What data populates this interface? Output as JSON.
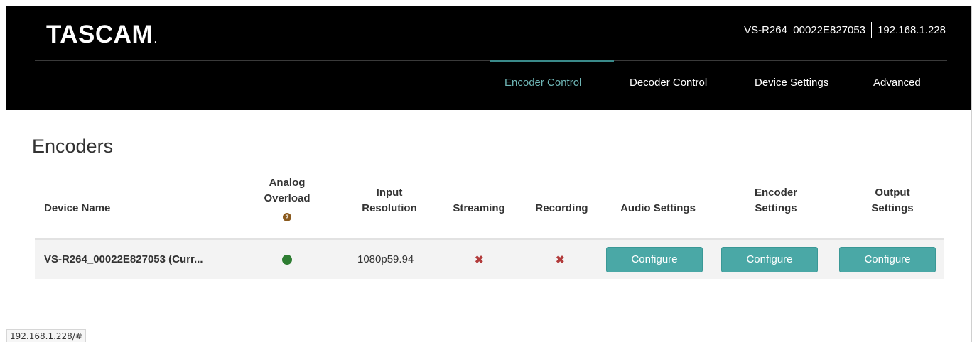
{
  "header": {
    "logo": "TASCAM",
    "logo_mark": ".",
    "device_name": "VS-R264_00022E827053",
    "ip_address": "192.168.1.228"
  },
  "nav": {
    "items": [
      {
        "label": "Encoder Control",
        "active": true
      },
      {
        "label": "Decoder Control",
        "active": false
      },
      {
        "label": "Device Settings",
        "active": false
      },
      {
        "label": "Advanced",
        "active": false
      }
    ]
  },
  "page": {
    "title": "Encoders"
  },
  "table": {
    "columns": {
      "device_name": "Device Name",
      "analog_overload_1": "Analog",
      "analog_overload_2": "Overload",
      "input_resolution_1": "Input",
      "input_resolution_2": "Resolution",
      "streaming": "Streaming",
      "recording": "Recording",
      "audio_settings": "Audio Settings",
      "encoder_settings_1": "Encoder",
      "encoder_settings_2": "Settings",
      "output_settings_1": "Output",
      "output_settings_2": "Settings"
    },
    "help_icon": "?",
    "rows": [
      {
        "device_name": "VS-R264_00022E827053 (Curr...",
        "analog_overload": "green-dot",
        "input_resolution": "1080p59.94",
        "streaming": "✖",
        "recording": "✖",
        "audio_button": "Configure",
        "encoder_button": "Configure",
        "output_button": "Configure"
      }
    ]
  },
  "statusbar": {
    "url": "192.168.1.228/#"
  },
  "colors": {
    "header_bg": "#000000",
    "accent": "#4aa8a6",
    "active_nav": "#6fb6b6",
    "status_ok": "#2e7d32",
    "status_off": "#b23b3b"
  }
}
